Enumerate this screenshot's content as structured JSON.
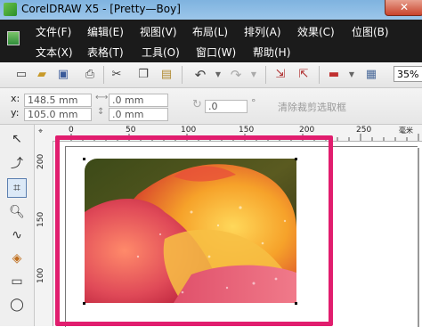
{
  "window": {
    "title": "CorelDRAW X5 - [Pretty—Boy]",
    "close_label": "✕"
  },
  "menu": {
    "row1": [
      "文件(F)",
      "编辑(E)",
      "视图(V)",
      "布局(L)",
      "排列(A)",
      "效果(C)",
      "位图(B)"
    ],
    "row2": [
      "文本(X)",
      "表格(T)",
      "工具(O)",
      "窗口(W)",
      "帮助(H)"
    ]
  },
  "toolbar": {
    "icons": [
      "new-icon",
      "open-icon",
      "save-icon",
      "print-icon",
      "cut-icon",
      "copy-icon",
      "paste-icon",
      "undo-icon",
      "redo-icon",
      "import-icon",
      "export-icon",
      "launcher-icon",
      "welcome-icon"
    ],
    "zoom": "35%"
  },
  "property_bar": {
    "x_label": "x:",
    "x_value": "148.5 mm",
    "y_label": "y:",
    "y_value": "105.0 mm",
    "w_value": ".0 mm",
    "h_value": ".0 mm",
    "angle_value": ".0",
    "angle_unit": "°",
    "clear_crop": "清除裁剪选取框"
  },
  "rulers": {
    "horizontal": [
      "0",
      "50",
      "100",
      "150",
      "200",
      "250"
    ],
    "vertical": [
      "200",
      "150",
      "100"
    ],
    "unit_marker": "毫米"
  },
  "colors": {
    "highlight": "#e11d6e",
    "menu_bg": "#1b1b1b",
    "title_bg": "#9cc6ea"
  }
}
